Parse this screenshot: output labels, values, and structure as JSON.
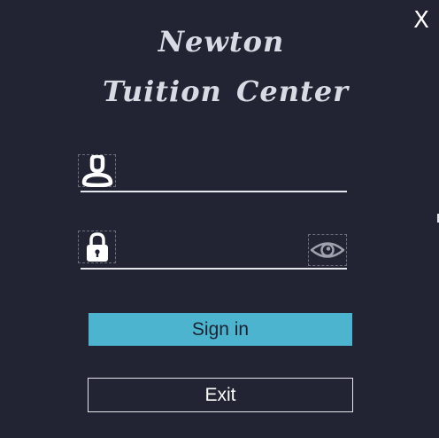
{
  "window": {
    "close_label": "X"
  },
  "brand": {
    "line1": "Newton",
    "line2": "Tuition Center"
  },
  "form": {
    "username": {
      "value": "",
      "placeholder": "",
      "icon": "user-icon"
    },
    "password": {
      "value": "",
      "placeholder": "",
      "icon": "lock-icon",
      "toggle_icon": "eye-icon"
    }
  },
  "buttons": {
    "signin_label": "Sign in",
    "exit_label": "Exit"
  },
  "colors": {
    "background": "#222433",
    "accent": "#4cb4cf",
    "text": "#ffffff"
  }
}
